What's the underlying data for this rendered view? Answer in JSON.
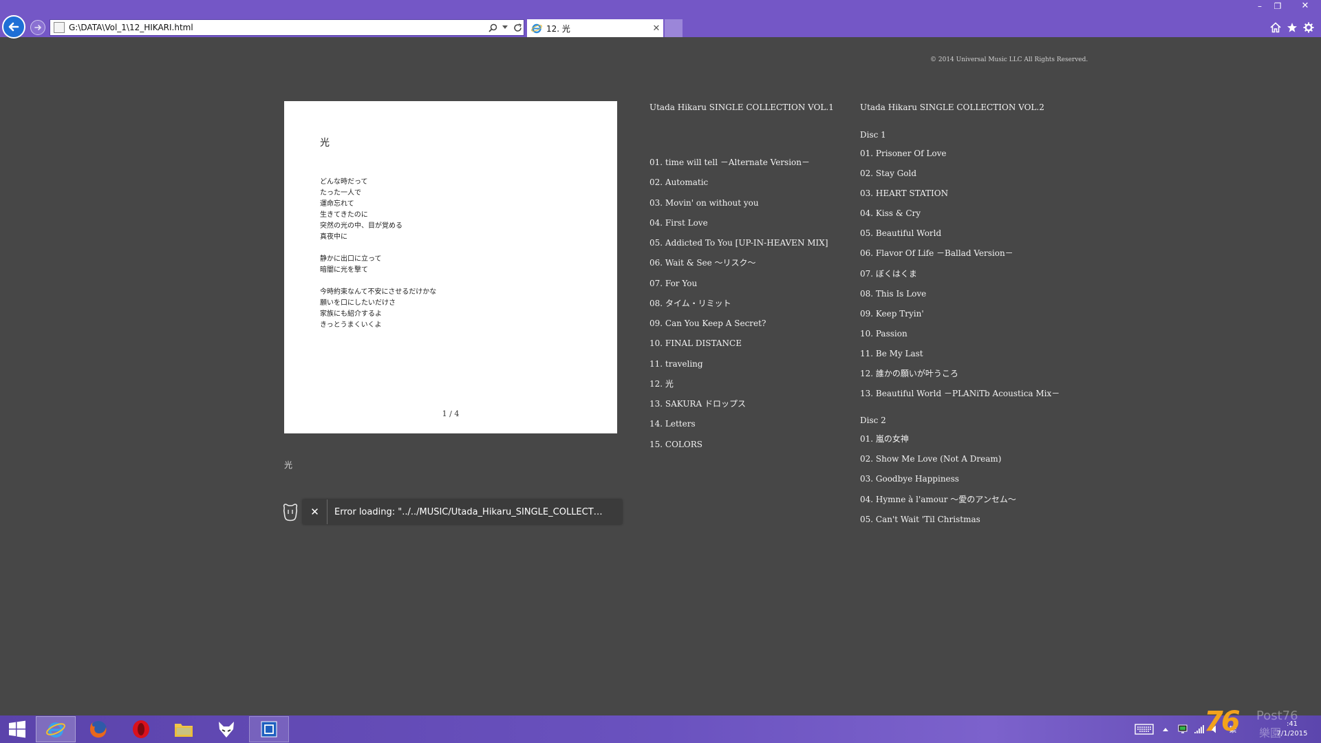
{
  "browser": {
    "address": "G:\\DATA\\Vol_1\\12_HIKARI.html",
    "tab_title": "12. 光",
    "window_controls": {
      "minimize": "–",
      "restore": "❐",
      "close": "✕"
    }
  },
  "page": {
    "copyright": "© 2014 Universal Music LLC All Rights Reserved.",
    "lyric_card": {
      "title": "光",
      "stanzas": [
        [
          "どんな時だって",
          "たった一人で",
          "運命忘れて",
          "生きてきたのに",
          "突然の光の中、目が覚める",
          "真夜中に"
        ],
        [
          "静かに出口に立って",
          "暗闇に光を撃て"
        ],
        [
          "今時約束なんて不安にさせるだけかな",
          "願いを口にしたいだけさ",
          "家族にも紹介するよ",
          "きっとうまくいくよ"
        ]
      ],
      "page_indicator": "1 / 4"
    },
    "song_caption": "光",
    "player": {
      "close_label": "✕",
      "error_text": "Error loading: \"../../MUSIC/Utada_Hikaru_SINGLE_COLLECT…"
    },
    "vol1": {
      "title": "Utada Hikaru SINGLE COLLECTION VOL.1",
      "tracks": [
        "01. time will tell －Alternate Version－",
        "02. Automatic",
        "03. Movin' on without you",
        "04. First Love",
        "05. Addicted To You [UP-IN-HEAVEN MIX]",
        "06. Wait & See ～リスク～",
        "07. For You",
        "08. タイム・リミット",
        "09. Can You Keep A Secret?",
        "10. FINAL DISTANCE",
        "11. traveling",
        "12. 光",
        "13. SAKURA ドロップス",
        "14. Letters",
        "15. COLORS"
      ]
    },
    "vol2": {
      "title": "Utada Hikaru SINGLE COLLECTION VOL.2",
      "disc1_label": "Disc 1",
      "disc1_tracks": [
        "01. Prisoner Of Love",
        "02. Stay Gold",
        "03. HEART STATION",
        "04. Kiss & Cry",
        "05. Beautiful World",
        "06. Flavor Of Life －Ballad Version－",
        "07. ぼくはくま",
        "08. This Is Love",
        "09. Keep Tryin'",
        "10. Passion",
        "11. Be My Last",
        "12. 誰かの願いが叶うころ",
        "13. Beautiful World －PLANiTb Acoustica Mix－"
      ],
      "disc2_label": "Disc 2",
      "disc2_tracks": [
        "01. 嵐の女神",
        "02. Show Me Love (Not A Dream)",
        "03. Goodbye Happiness",
        "04. Hymne à l'amour ～愛のアンセム～",
        "05. Can't Wait 'Til Christmas"
      ]
    }
  },
  "taskbar": {
    "apps": [
      "start-icon",
      "internet-explorer-icon",
      "firefox-icon",
      "opera-icon",
      "file-explorer-icon",
      "foobar-fox-icon",
      "app-icon"
    ],
    "ime": "繁",
    "clock_time": ":41",
    "clock_date": "7/1/2015"
  },
  "watermark": {
    "number": "76",
    "brand": "Post76",
    "sub": "樂園"
  },
  "colors": {
    "chrome": "#7457c6",
    "page_bg": "#474747",
    "card_bg": "#ffffff",
    "back_button": "#1e6fd6",
    "watermark_orange": "#f2a21c"
  }
}
